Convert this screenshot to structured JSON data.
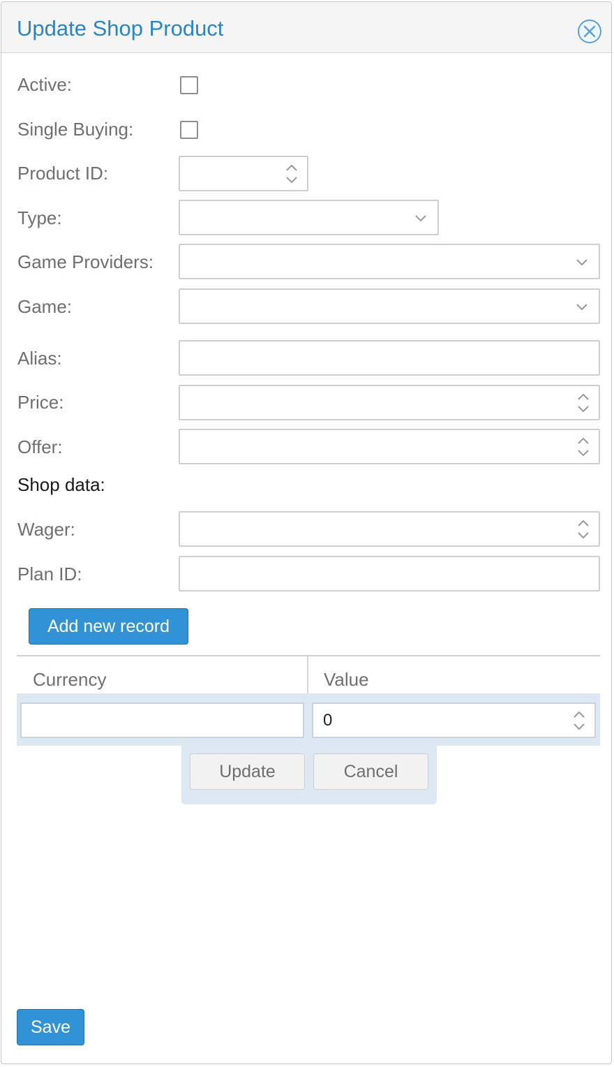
{
  "dialog": {
    "title": "Update Shop Product",
    "close_icon": "close-circle-icon"
  },
  "form": {
    "active": {
      "label": "Active:",
      "checked": false
    },
    "single_buying": {
      "label": "Single Buying:",
      "checked": false
    },
    "product_id": {
      "label": "Product ID:",
      "value": ""
    },
    "type": {
      "label": "Type:",
      "value": ""
    },
    "game_providers": {
      "label": "Game Providers:",
      "value": ""
    },
    "game": {
      "label": "Game:",
      "value": ""
    },
    "alias": {
      "label": "Alias:",
      "value": ""
    },
    "price": {
      "label": "Price:",
      "value": ""
    },
    "offer": {
      "label": "Offer:",
      "value": ""
    }
  },
  "shop_data": {
    "heading": "Shop data:",
    "wager": {
      "label": "Wager:",
      "value": ""
    },
    "plan_id": {
      "label": "Plan ID:",
      "value": ""
    }
  },
  "records": {
    "add_button": "Add new record",
    "columns": [
      "Currency",
      "Value"
    ],
    "edit_row": {
      "currency": "",
      "value": "0"
    },
    "update_button": "Update",
    "cancel_button": "Cancel"
  },
  "footer": {
    "save_button": "Save"
  },
  "colors": {
    "accent": "#2b84c8",
    "primary_button": "#3192d6",
    "edit_row_bg": "#dde8f2"
  }
}
